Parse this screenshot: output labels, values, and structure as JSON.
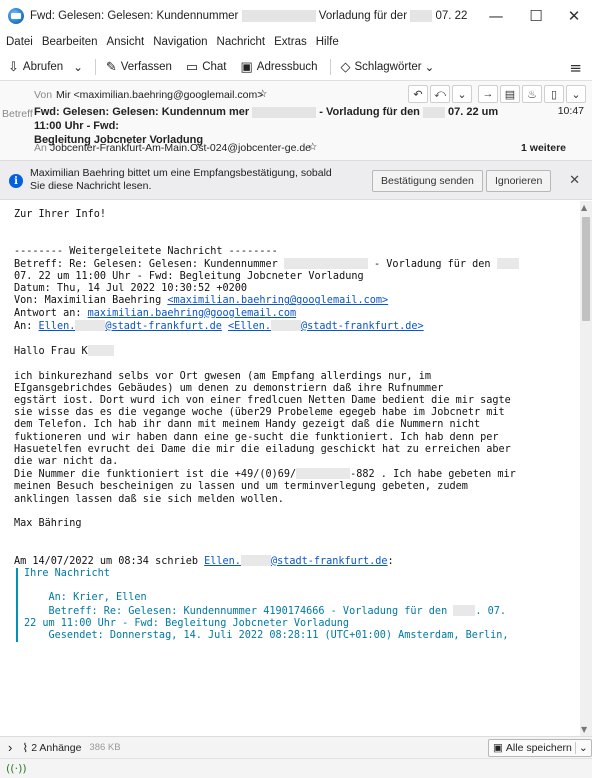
{
  "window": {
    "title_prefix": "Fwd: Gelesen: Gelesen: Kundennummer",
    "title_mid": "Vorladung für der",
    "title_suffix": "07. 22 um 11:00 Uhr...",
    "minimize": "—",
    "maximize": "☐",
    "close": "✕"
  },
  "menu": [
    "Datei",
    "Bearbeiten",
    "Ansicht",
    "Navigation",
    "Nachricht",
    "Extras",
    "Hilfe"
  ],
  "toolbar": {
    "fetch": "Abrufen",
    "compose": "Verfassen",
    "chat": "Chat",
    "addressbook": "Adressbuch",
    "tags": "Schlagwörter"
  },
  "header": {
    "from_label": "Von",
    "from_value": "Mir <maximilian.baehring@googlemail.com>",
    "subject_label": "Betreff",
    "subject_part1": "Fwd: Gelesen: Gelesen: Kundennum mer",
    "subject_part2": "- Vorladung für den",
    "subject_part3": "07. 22 um 11:00 Uhr - Fwd:",
    "subject_line2": "Begleitung Jobcneter Vorladung",
    "time": "10:47",
    "to_label": "An",
    "to_value": "Jobcenter-Frankfurt-Am-Main.Ost-024@jobcenter-ge.de",
    "more": "1 weitere"
  },
  "notification": {
    "text": "Maximilian Baehring bittet um eine Empfangsbestätigung, sobald Sie diese Nachricht lesen.",
    "confirm": "Bestätigung senden",
    "ignore": "Ignorieren",
    "close": "✕"
  },
  "body": {
    "l01": "Zur Ihrer Info!",
    "l02": "-------- Weitergeleitete Nachricht --------",
    "l03a": "Betreff: Re: Gelesen: Gelesen: Kundennummer",
    "l03b": "- Vorladung für den",
    "l04": "07. 22 um 11:00 Uhr - Fwd: Begleitung Jobcneter Vorladung",
    "l05": "Datum: Thu, 14 Jul 2022 10:30:52 +0200",
    "l06a": "Von: Maximilian Baehring ",
    "l06b": "<maximilian.baehring@googlemail.com>",
    "l07a": "Antwort an: ",
    "l07b": "maximilian.baehring@googlemail.com",
    "l08a": "An: ",
    "l08b": "Ellen.",
    "l08c": "@stadt-frankfurt.de",
    "l08d": "<Ellen.",
    "l08e": "@stadt-frankfurt.de>",
    "l09": "Hallo Frau K",
    "p1": "ich binkurezhand selbs vor Ort gwesen (am Empfang allerdings nur, im\nEIgansgebrichdes Gebäudes) um denen zu demonstriern daß ihre Rufnummer\negstärt iost. Dort wurd ich von einer fredlcuen Netten Dame bedient die mir sagte\nsie wisse das es die vegange woche (über29 Probeleme egegeb habe im Jobcnetr mit\ndem Telefon. Ich hab ihr dann mit meinem Handy gezeigt daß die Nummern nicht\nfuktioneren und wir haben dann eine ge-sucht die funktioniert. Ich hab denn per\nHasuetelfen evrucht dei Dame die mir die eiladung geschickt hat zu erreichen aber\ndie war nicht da.",
    "p2a": "Die Nummer die funktioniert ist die +49/(0)69/",
    "p2b": "-882 . Ich habe gebeten mir",
    "p2c": "meinen Besuch bescheinigen zu lassen und um terminverlegung gebeten, zudem\nanklingen lassen daß sie sich melden wollen.",
    "sig": "Max Bähring",
    "q1a": "Am 14/07/2022 um 08:34 schrieb ",
    "q1b": "Ellen.",
    "q1c": "@stadt-frankfurt.de",
    "q1d": ":",
    "quote_title": "Ihre Nachricht",
    "quote_to": "    An: Krier, Ellen",
    "quote_subj1": "    Betreff: Re: Gelesen: Kundennummer 4190174666 - Vorladung für den",
    "quote_subj1b": ". 07.",
    "quote_subj2": "22 um 11:00 Uhr - Fwd: Begleitung Jobcneter Vorladung",
    "quote_sent": "    Gesendet: Donnerstag, 14. Juli 2022 08:28:11 (UTC+01:00) Amsterdam, Berlin,"
  },
  "attachments": {
    "toggle": "›",
    "label": "2 Anhänge",
    "size": "386 KB",
    "save_all": "Alle speichern"
  }
}
